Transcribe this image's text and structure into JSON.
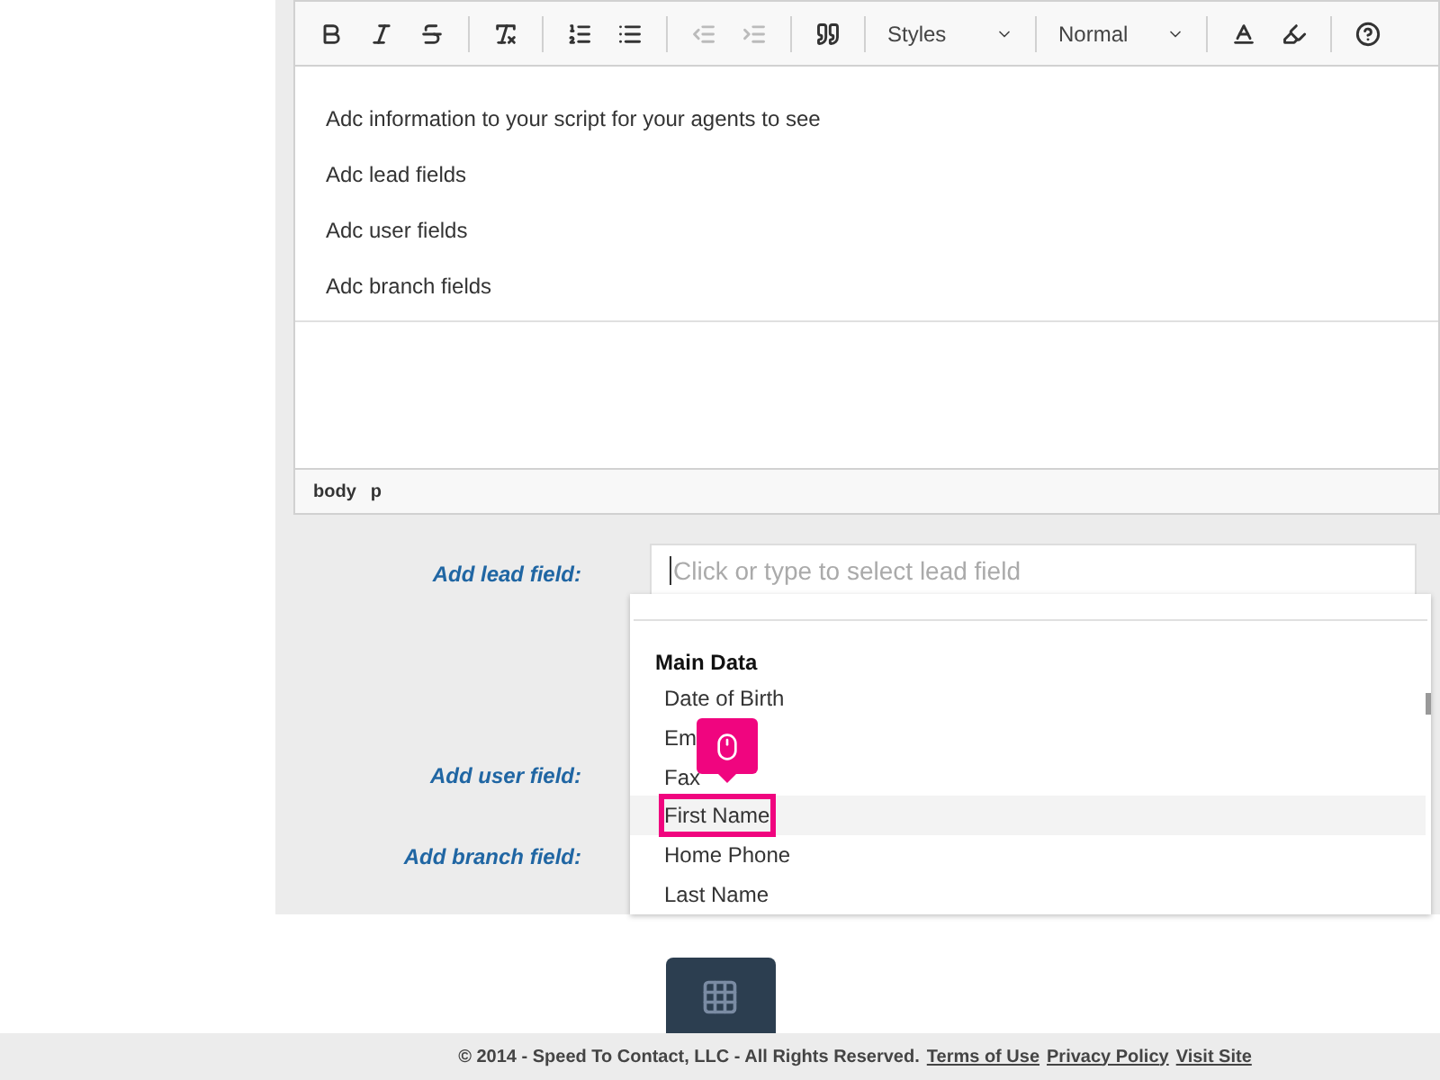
{
  "toolbar": [
    {
      "kind": "bold",
      "disabled": false
    },
    {
      "kind": "italic",
      "disabled": false
    },
    {
      "kind": "strike",
      "disabled": false
    },
    {
      "kind": "sep"
    },
    {
      "kind": "clear",
      "disabled": false
    },
    {
      "kind": "sep"
    },
    {
      "kind": "ol",
      "disabled": false
    },
    {
      "kind": "ul",
      "disabled": false
    },
    {
      "kind": "sep"
    },
    {
      "kind": "outdent",
      "disabled": true
    },
    {
      "kind": "indent",
      "disabled": true
    },
    {
      "kind": "sep"
    },
    {
      "kind": "quote",
      "disabled": false
    },
    {
      "kind": "sep"
    },
    {
      "kind": "select",
      "label": "Styles"
    },
    {
      "kind": "sep"
    },
    {
      "kind": "select",
      "label": "Normal"
    },
    {
      "kind": "sep"
    },
    {
      "kind": "textcolor",
      "disabled": false
    },
    {
      "kind": "bgcolor",
      "disabled": false
    },
    {
      "kind": "sep"
    },
    {
      "kind": "help",
      "disabled": false
    }
  ],
  "editor": {
    "paragraphs": [
      "Adc information to your script for your agents to see",
      "Adc lead fields",
      "Adc user fields",
      "Adc branch fields"
    ],
    "path": [
      "body",
      "p"
    ]
  },
  "form": {
    "fields": [
      {
        "label": "Add lead field:",
        "placeholder": "Click or type to select lead field"
      },
      {
        "label": "Add user field:"
      },
      {
        "label": "Add branch field:"
      }
    ]
  },
  "dropdown": {
    "group": "Main Data",
    "items": [
      {
        "label": "Date of Birth",
        "selected": false
      },
      {
        "label": "Em",
        "selected": false
      },
      {
        "label": "Fax",
        "selected": false
      },
      {
        "label": "First Name",
        "selected": true
      },
      {
        "label": "Home Phone",
        "selected": false
      },
      {
        "label": "Last Name",
        "selected": false
      }
    ]
  },
  "footer": {
    "text": "© 2014 - Speed To Contact, LLC - All Rights Reserved.",
    "links": [
      "Terms of Use",
      "Privacy Policy",
      "Visit Site"
    ]
  }
}
